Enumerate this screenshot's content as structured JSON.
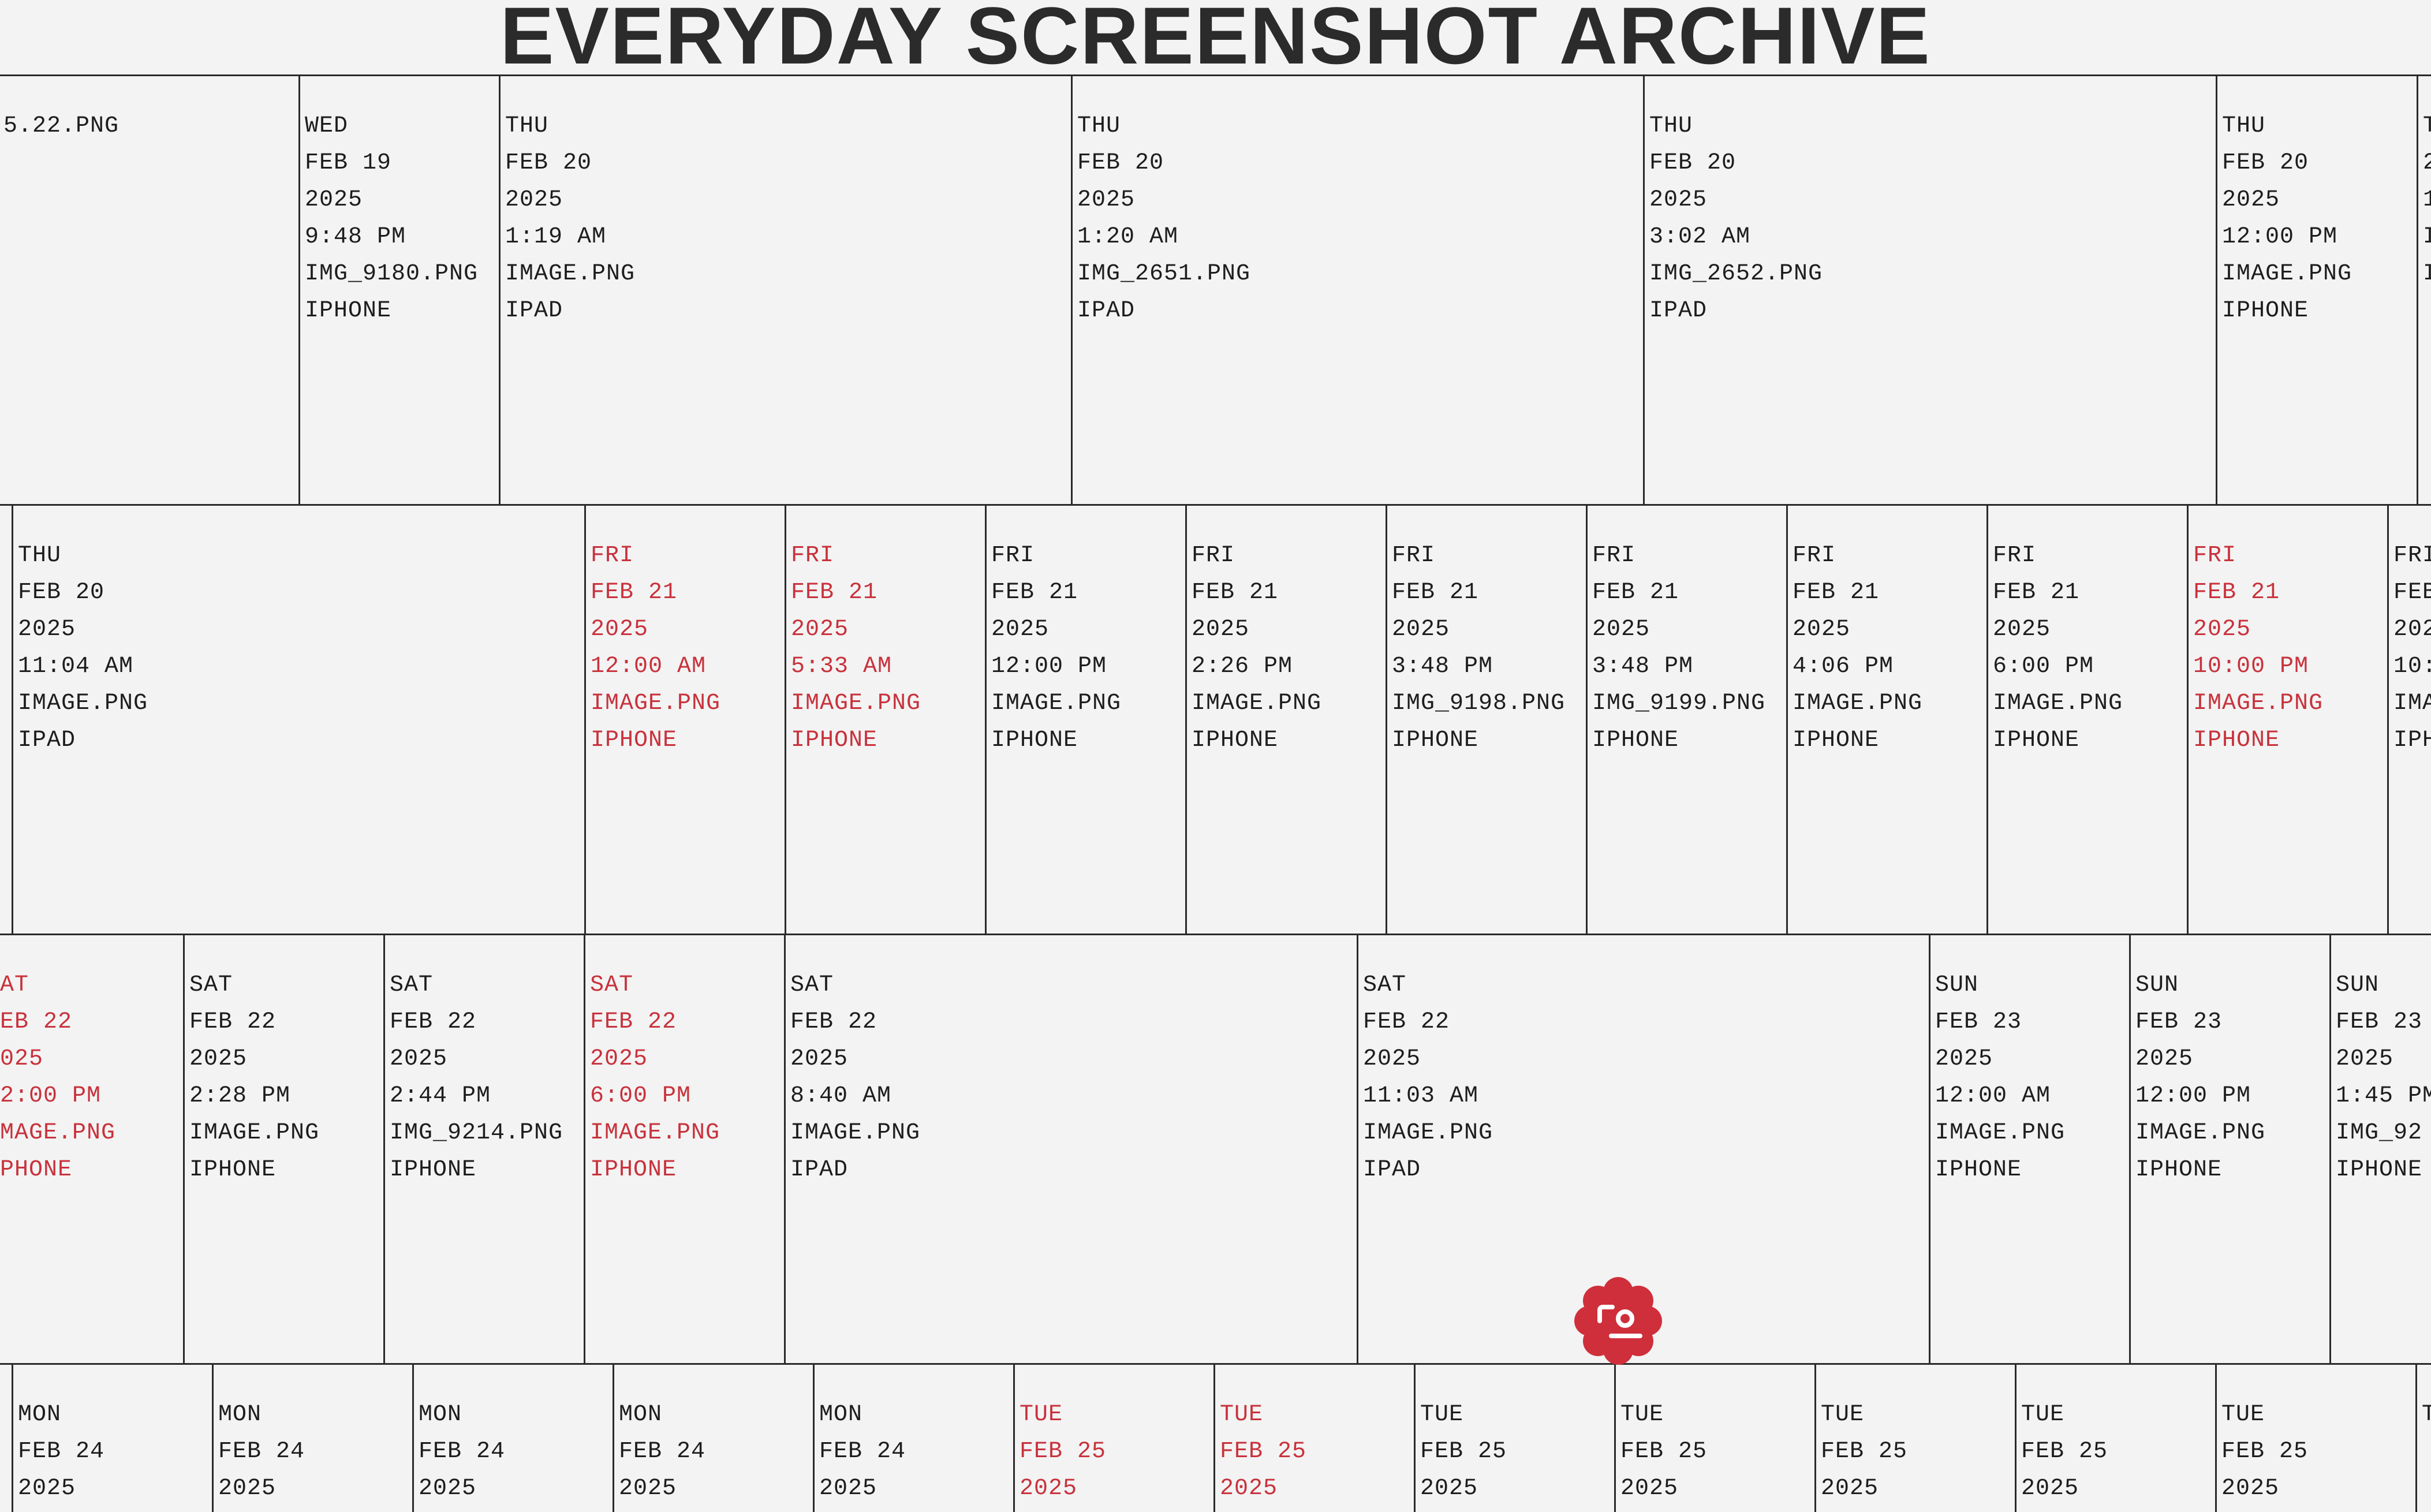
{
  "title": "EVERYDAY SCREENSHOT ARCHIVE",
  "accent_color": "#c8323c",
  "text_color": "#1d1d1d",
  "badge_icon": "flower-user-icon",
  "rows": [
    [
      {
        "day": "",
        "date": "",
        "year": "",
        "time": "",
        "file": "5.22.PNG",
        "device": "",
        "red": false
      },
      {
        "day": "WED",
        "date": "FEB 19",
        "year": "2025",
        "time": "9:48 PM",
        "file": "IMG_9180.PNG",
        "device": "IPHONE",
        "red": false
      },
      {
        "day": "THU",
        "date": "FEB 20",
        "year": "2025",
        "time": "1:19 AM",
        "file": "IMAGE.PNG",
        "device": "IPAD",
        "red": false
      },
      {
        "day": "THU",
        "date": "FEB 20",
        "year": "2025",
        "time": "1:20 AM",
        "file": "IMG_2651.PNG",
        "device": "IPAD",
        "red": false
      },
      {
        "day": "THU",
        "date": "FEB 20",
        "year": "2025",
        "time": "3:02 AM",
        "file": "IMG_2652.PNG",
        "device": "IPAD",
        "red": false
      },
      {
        "day": "THU",
        "date": "FEB 20",
        "year": "2025",
        "time": "12:00 PM",
        "file": "IMAGE.PNG",
        "device": "IPHONE",
        "red": false
      },
      {
        "day": "T",
        "date": "",
        "year": "2",
        "time": "1",
        "file": "I",
        "device": "I",
        "red": false
      }
    ],
    [
      {
        "day": "",
        "date": "",
        "year": "",
        "time": "",
        "file": "",
        "device": "",
        "red": false
      },
      {
        "day": "THU",
        "date": "FEB 20",
        "year": "2025",
        "time": "11:04 AM",
        "file": "IMAGE.PNG",
        "device": "IPAD",
        "red": false
      },
      {
        "day": "FRI",
        "date": "FEB 21",
        "year": "2025",
        "time": "12:00 AM",
        "file": "IMAGE.PNG",
        "device": "IPHONE",
        "red": true
      },
      {
        "day": "FRI",
        "date": "FEB 21",
        "year": "2025",
        "time": "5:33 AM",
        "file": "IMAGE.PNG",
        "device": "IPHONE",
        "red": true
      },
      {
        "day": "FRI",
        "date": "FEB 21",
        "year": "2025",
        "time": "12:00 PM",
        "file": "IMAGE.PNG",
        "device": "IPHONE",
        "red": false
      },
      {
        "day": "FRI",
        "date": "FEB 21",
        "year": "2025",
        "time": "2:26 PM",
        "file": "IMAGE.PNG",
        "device": "IPHONE",
        "red": false
      },
      {
        "day": "FRI",
        "date": "FEB 21",
        "year": "2025",
        "time": "3:48 PM",
        "file": "IMG_9198.PNG",
        "device": "IPHONE",
        "red": false
      },
      {
        "day": "FRI",
        "date": "FEB 21",
        "year": "2025",
        "time": "3:48 PM",
        "file": "IMG_9199.PNG",
        "device": "IPHONE",
        "red": false
      },
      {
        "day": "FRI",
        "date": "FEB 21",
        "year": "2025",
        "time": "4:06 PM",
        "file": "IMAGE.PNG",
        "device": "IPHONE",
        "red": false
      },
      {
        "day": "FRI",
        "date": "FEB 21",
        "year": "2025",
        "time": "6:00 PM",
        "file": "IMAGE.PNG",
        "device": "IPHONE",
        "red": false
      },
      {
        "day": "FRI",
        "date": "FEB 21",
        "year": "2025",
        "time": "10:00 PM",
        "file": "IMAGE.PNG",
        "device": "IPHONE",
        "red": true
      },
      {
        "day": "FRI",
        "date": "FEB",
        "year": "202",
        "time": "10:",
        "file": "IMA",
        "device": "IPH",
        "red": false
      }
    ],
    [
      {
        "day": "AT",
        "date": "EB 22",
        "year": "025",
        "time": "2:00 PM",
        "file": "MAGE.PNG",
        "device": "PHONE",
        "red": true
      },
      {
        "day": "SAT",
        "date": "FEB 22",
        "year": "2025",
        "time": "2:28 PM",
        "file": "IMAGE.PNG",
        "device": "IPHONE",
        "red": false
      },
      {
        "day": "SAT",
        "date": "FEB 22",
        "year": "2025",
        "time": "2:44 PM",
        "file": "IMG_9214.PNG",
        "device": "IPHONE",
        "red": false
      },
      {
        "day": "SAT",
        "date": "FEB 22",
        "year": "2025",
        "time": "6:00 PM",
        "file": "IMAGE.PNG",
        "device": "IPHONE",
        "red": true
      },
      {
        "day": "SAT",
        "date": "FEB 22",
        "year": "2025",
        "time": "8:40 AM",
        "file": "IMAGE.PNG",
        "device": "IPAD",
        "red": false
      },
      {
        "day": "SAT",
        "date": "FEB 22",
        "year": "2025",
        "time": "11:03 AM",
        "file": "IMAGE.PNG",
        "device": "IPAD",
        "red": false
      },
      {
        "day": "SUN",
        "date": "FEB 23",
        "year": "2025",
        "time": "12:00 AM",
        "file": "IMAGE.PNG",
        "device": "IPHONE",
        "red": false
      },
      {
        "day": "SUN",
        "date": "FEB 23",
        "year": "2025",
        "time": "12:00 PM",
        "file": "IMAGE.PNG",
        "device": "IPHONE",
        "red": false
      },
      {
        "day": "SUN",
        "date": "FEB 23",
        "year": "2025",
        "time": "1:45 PM",
        "file": "IMG_92",
        "device": "IPHONE",
        "red": false
      }
    ],
    [
      {
        "day": "",
        "date": "",
        "year": "",
        "time": "",
        "file": "",
        "device": "",
        "red": false
      },
      {
        "day": "MON",
        "date": "FEB 24",
        "year": "2025",
        "time": "",
        "file": "",
        "device": "",
        "red": false
      },
      {
        "day": "MON",
        "date": "FEB 24",
        "year": "2025",
        "time": "",
        "file": "",
        "device": "",
        "red": false
      },
      {
        "day": "MON",
        "date": "FEB 24",
        "year": "2025",
        "time": "",
        "file": "",
        "device": "",
        "red": false
      },
      {
        "day": "MON",
        "date": "FEB 24",
        "year": "2025",
        "time": "",
        "file": "",
        "device": "",
        "red": false
      },
      {
        "day": "MON",
        "date": "FEB 24",
        "year": "2025",
        "time": "",
        "file": "",
        "device": "",
        "red": false
      },
      {
        "day": "TUE",
        "date": "FEB 25",
        "year": "2025",
        "time": "",
        "file": "",
        "device": "",
        "red": true
      },
      {
        "day": "TUE",
        "date": "FEB 25",
        "year": "2025",
        "time": "",
        "file": "",
        "device": "",
        "red": true
      },
      {
        "day": "TUE",
        "date": "FEB 25",
        "year": "2025",
        "time": "",
        "file": "",
        "device": "",
        "red": false
      },
      {
        "day": "TUE",
        "date": "FEB 25",
        "year": "2025",
        "time": "",
        "file": "",
        "device": "",
        "red": false
      },
      {
        "day": "TUE",
        "date": "FEB 25",
        "year": "2025",
        "time": "",
        "file": "",
        "device": "",
        "red": false
      },
      {
        "day": "TUE",
        "date": "FEB 25",
        "year": "2025",
        "time": "",
        "file": "",
        "device": "",
        "red": false
      },
      {
        "day": "TUE",
        "date": "FEB 25",
        "year": "2025",
        "time": "",
        "file": "",
        "device": "",
        "red": false
      },
      {
        "day": "T",
        "date": "",
        "year": "",
        "time": "",
        "file": "",
        "device": "",
        "red": false
      }
    ]
  ]
}
